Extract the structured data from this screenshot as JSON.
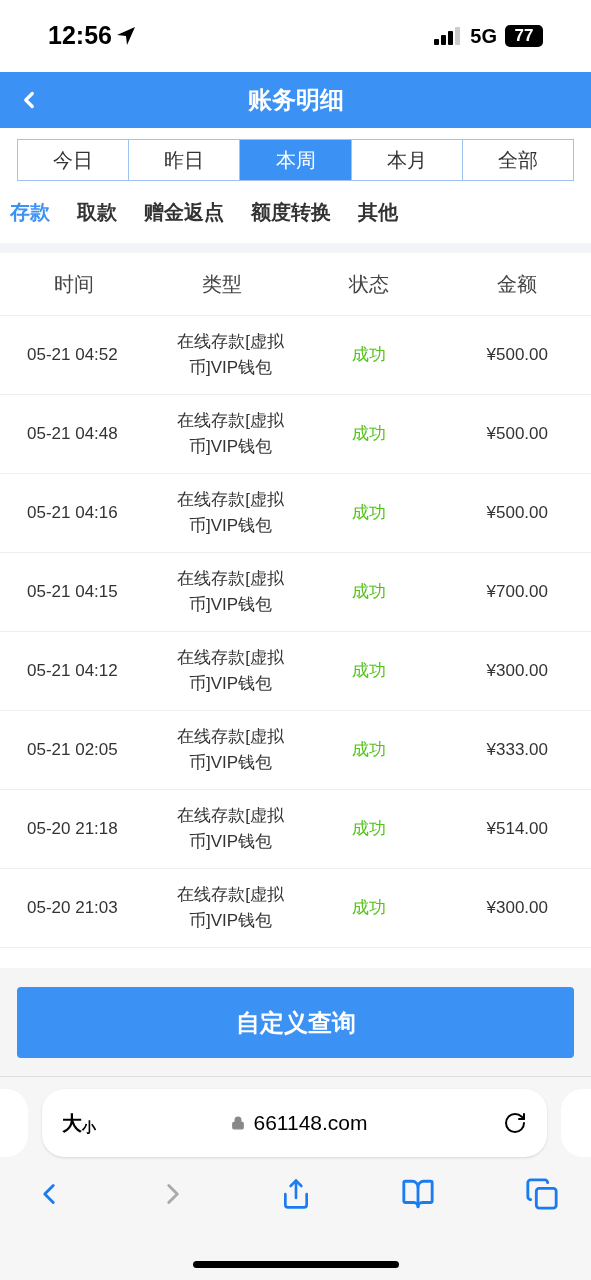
{
  "status_bar": {
    "time": "12:56",
    "network": "5G",
    "battery": "77"
  },
  "header": {
    "title": "账务明细"
  },
  "periods": [
    {
      "label": "今日",
      "selected": false
    },
    {
      "label": "昨日",
      "selected": false
    },
    {
      "label": "本周",
      "selected": true
    },
    {
      "label": "本月",
      "selected": false
    },
    {
      "label": "全部",
      "selected": false
    }
  ],
  "categories": [
    {
      "label": "存款",
      "selected": true
    },
    {
      "label": "取款",
      "selected": false
    },
    {
      "label": "赠金返点",
      "selected": false
    },
    {
      "label": "额度转换",
      "selected": false
    },
    {
      "label": "其他",
      "selected": false
    }
  ],
  "table": {
    "columns": [
      "时间",
      "类型",
      "状态",
      "金额"
    ],
    "rows": [
      {
        "time": "05-21 04:52",
        "type": "在线存款[虚拟币]VIP钱包",
        "status": "成功",
        "amount": "¥500.00"
      },
      {
        "time": "05-21 04:48",
        "type": "在线存款[虚拟币]VIP钱包",
        "status": "成功",
        "amount": "¥500.00"
      },
      {
        "time": "05-21 04:16",
        "type": "在线存款[虚拟币]VIP钱包",
        "status": "成功",
        "amount": "¥500.00"
      },
      {
        "time": "05-21 04:15",
        "type": "在线存款[虚拟币]VIP钱包",
        "status": "成功",
        "amount": "¥700.00"
      },
      {
        "time": "05-21 04:12",
        "type": "在线存款[虚拟币]VIP钱包",
        "status": "成功",
        "amount": "¥300.00"
      },
      {
        "time": "05-21 02:05",
        "type": "在线存款[虚拟币]VIP钱包",
        "status": "成功",
        "amount": "¥333.00"
      },
      {
        "time": "05-20 21:18",
        "type": "在线存款[虚拟币]VIP钱包",
        "status": "成功",
        "amount": "¥514.00"
      },
      {
        "time": "05-20 21:03",
        "type": "在线存款[虚拟币]VIP钱包",
        "status": "成功",
        "amount": "¥300.00"
      }
    ]
  },
  "query_button": "自定义查询",
  "browser": {
    "text_size_large": "大",
    "text_size_small": "小",
    "url": "661148.com"
  }
}
